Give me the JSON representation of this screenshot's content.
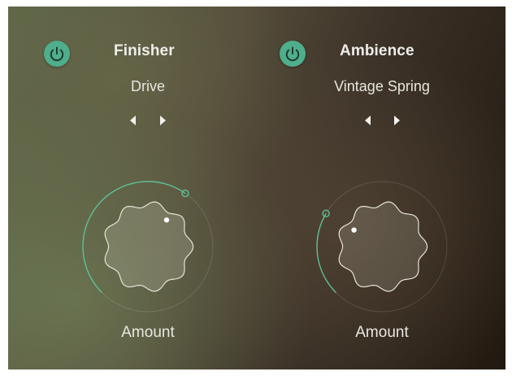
{
  "modules": [
    {
      "title": "Finisher",
      "enabled": true,
      "preset": "Drive",
      "knob_label": "Amount",
      "amount": 0.63
    },
    {
      "title": "Ambience",
      "enabled": true,
      "preset": "Vintage Spring",
      "knob_label": "Amount",
      "amount": 0.28
    }
  ],
  "icons": {
    "power": "power-icon",
    "prev": "arrow-left-icon",
    "next": "arrow-right-icon"
  },
  "colors": {
    "accent": "#4fae8c",
    "knob_line": "#5fbf98",
    "text": "#eeeeea"
  }
}
